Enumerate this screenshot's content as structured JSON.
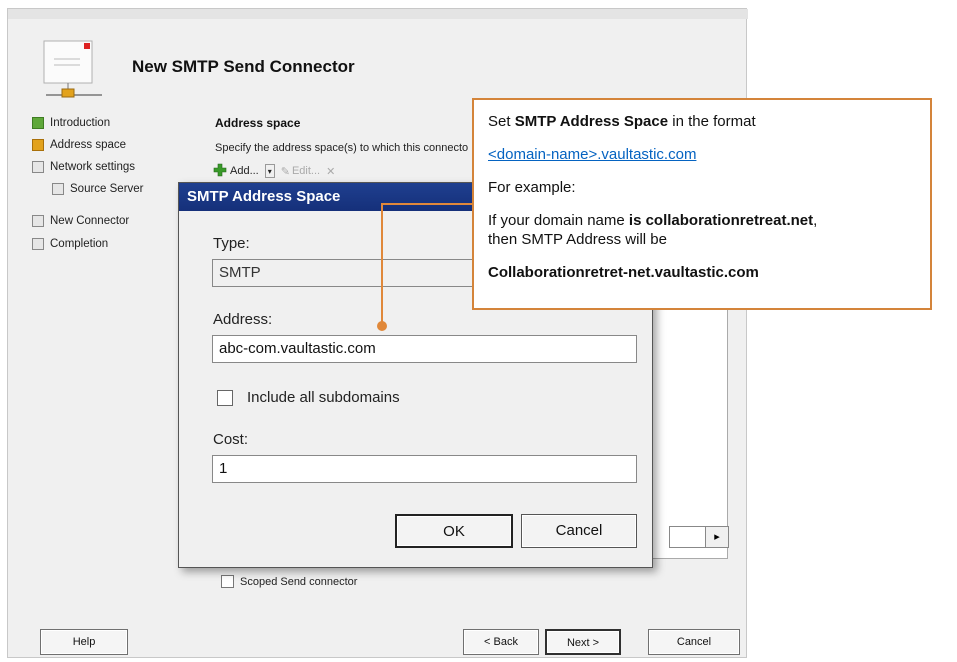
{
  "wizard": {
    "title": "New SMTP Send Connector",
    "steps": [
      {
        "label": "Introduction",
        "state": "complete"
      },
      {
        "label": "Address space",
        "state": "current"
      },
      {
        "label": "Network settings",
        "state": "pending"
      },
      {
        "label": "Source Server",
        "state": "pending"
      },
      {
        "label": "New Connector",
        "state": "pending"
      },
      {
        "label": "Completion",
        "state": "pending"
      }
    ],
    "section_heading": "Address space",
    "section_description": "Specify the address space(s) to which this connector",
    "toolbar": {
      "add_label": "Add...",
      "edit_label": "Edit...",
      "delete_glyph": "✕"
    },
    "scoped_label": "Scoped Send connector",
    "buttons": {
      "help": "Help",
      "back": "< Back",
      "next": "Next >",
      "cancel": "Cancel"
    }
  },
  "dialog": {
    "title": "SMTP Address Space",
    "type_label": "Type:",
    "type_value": "SMTP",
    "address_label": "Address:",
    "address_value": "abc-com.vaultastic.com",
    "subdomains_label": "Include all subdomains",
    "subdomains_checked": false,
    "cost_label": "Cost:",
    "cost_value": "1",
    "ok_label": "OK",
    "cancel_label": "Cancel"
  },
  "callout": {
    "line1_pre": "Set ",
    "line1_bold": "SMTP Address Space",
    "line1_post": " in the format",
    "format_link": "<domain-name>.vaultastic.com",
    "example_label": "For example:",
    "line4_pre": "If your  domain name ",
    "line4_bold": "is collaborationretreat.net",
    "line4_post": ",",
    "line5": "then SMTP  Address will be",
    "result": "Collaborationretret-net.vaultastic.com"
  },
  "colors": {
    "callout_border": "#d4843a",
    "dialog_title_bg": "#1f3f8f",
    "link": "#0563c1"
  }
}
